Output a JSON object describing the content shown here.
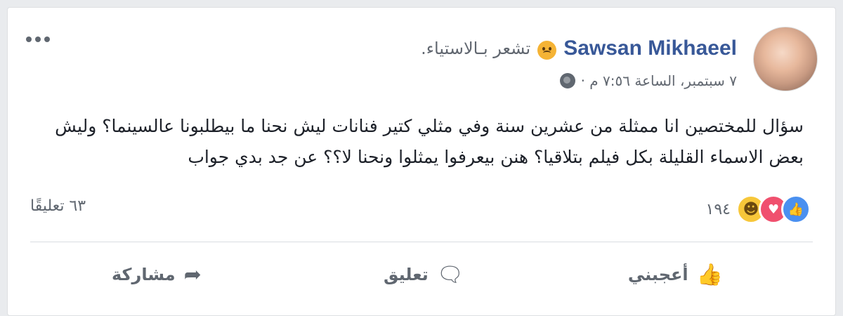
{
  "post": {
    "author": "Sawsan Mikhaeel",
    "feeling": "تشعر بـالاستياء.",
    "date": "٧ سبتمبر، الساعة ٧:٥٦ م ·",
    "text": "سؤال للمختصين انا ممثلة من عشرين سنة وفي مثلي كتير فنانات ليش نحنا ما بيطلبونا عالسينما؟ وليش بعض الاسماء القليلة بكل فيلم بتلاقيا؟ هنن بيعرفوا يمثلوا ونحنا لا؟؟ عن جد بدي جواب",
    "reactions_count": "١٩٤",
    "comments_count": "٦٣ تعليقًا"
  },
  "actions": {
    "like": "أعجبني",
    "comment": "تعليق",
    "share": "مشاركة"
  },
  "icons": {
    "more": "more-dots-icon",
    "feeling": "annoyed-face-icon",
    "privacy": "globe-icon",
    "like_reaction": "like-reaction-icon",
    "love_reaction": "love-reaction-icon",
    "haha_reaction": "haha-reaction-icon",
    "like_action": "thumbs-up-icon",
    "comment_action": "comment-bubble-icon",
    "share_action": "share-arrow-icon"
  },
  "colors": {
    "author": "#385898",
    "like": "#4a90f0",
    "love": "#f0506e",
    "haha": "#f7c73a",
    "secondary_text": "#606770"
  }
}
